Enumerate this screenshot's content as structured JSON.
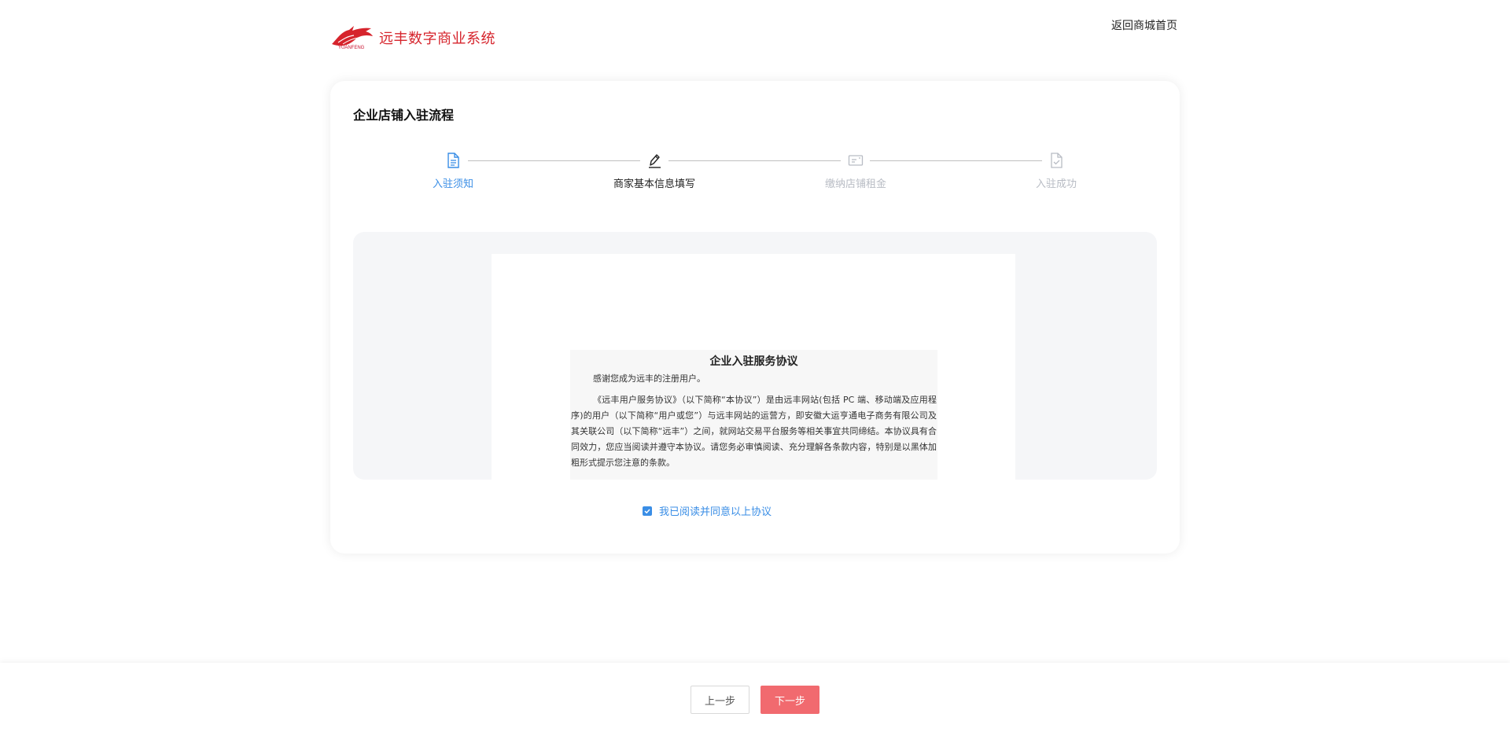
{
  "header": {
    "brand_logo_text": "YUANFENG",
    "app_title": "远丰数字商业系统",
    "back_link": "返回商城首页"
  },
  "card": {
    "title": "企业店铺入驻流程"
  },
  "steps": [
    {
      "label": "入驻须知",
      "state": "done",
      "icon": "document-icon"
    },
    {
      "label": "商家基本信息填写",
      "state": "active",
      "icon": "pen-icon"
    },
    {
      "label": "缴纳店铺租金",
      "state": "todo",
      "icon": "payment-card-icon"
    },
    {
      "label": "入驻成功",
      "state": "todo",
      "icon": "document-check-icon"
    }
  ],
  "agreement": {
    "title": "企业入驻服务协议",
    "greeting": "感谢您成为远丰的注册用户。",
    "body": "《远丰用户服务协议》（以下简称“本协议”）是由远丰网站(包括 PC 端、移动端及应用程序)的用户（以下简称“用户或您”）与远丰网站的运营方，即安徽大运亨通电子商务有限公司及其关联公司（以下简称“远丰”）之间，就网站交易平台服务等相关事宜共同缔结。本协议具有合同效力，您应当阅读并遵守本协议。请您务必审慎阅读、充分理解各条款内容，特别是以黑体加粗形式提示您注意的条款。"
  },
  "agree": {
    "checked": true,
    "label": "我已阅读并同意以上协议"
  },
  "footer": {
    "prev_label": "上一步",
    "next_label": "下一步"
  },
  "colors": {
    "accent_blue": "#3a8ee6",
    "brand_red": "#d6242c",
    "next_button": "#f16a6f",
    "inactive_step": "#b8bcc4"
  }
}
